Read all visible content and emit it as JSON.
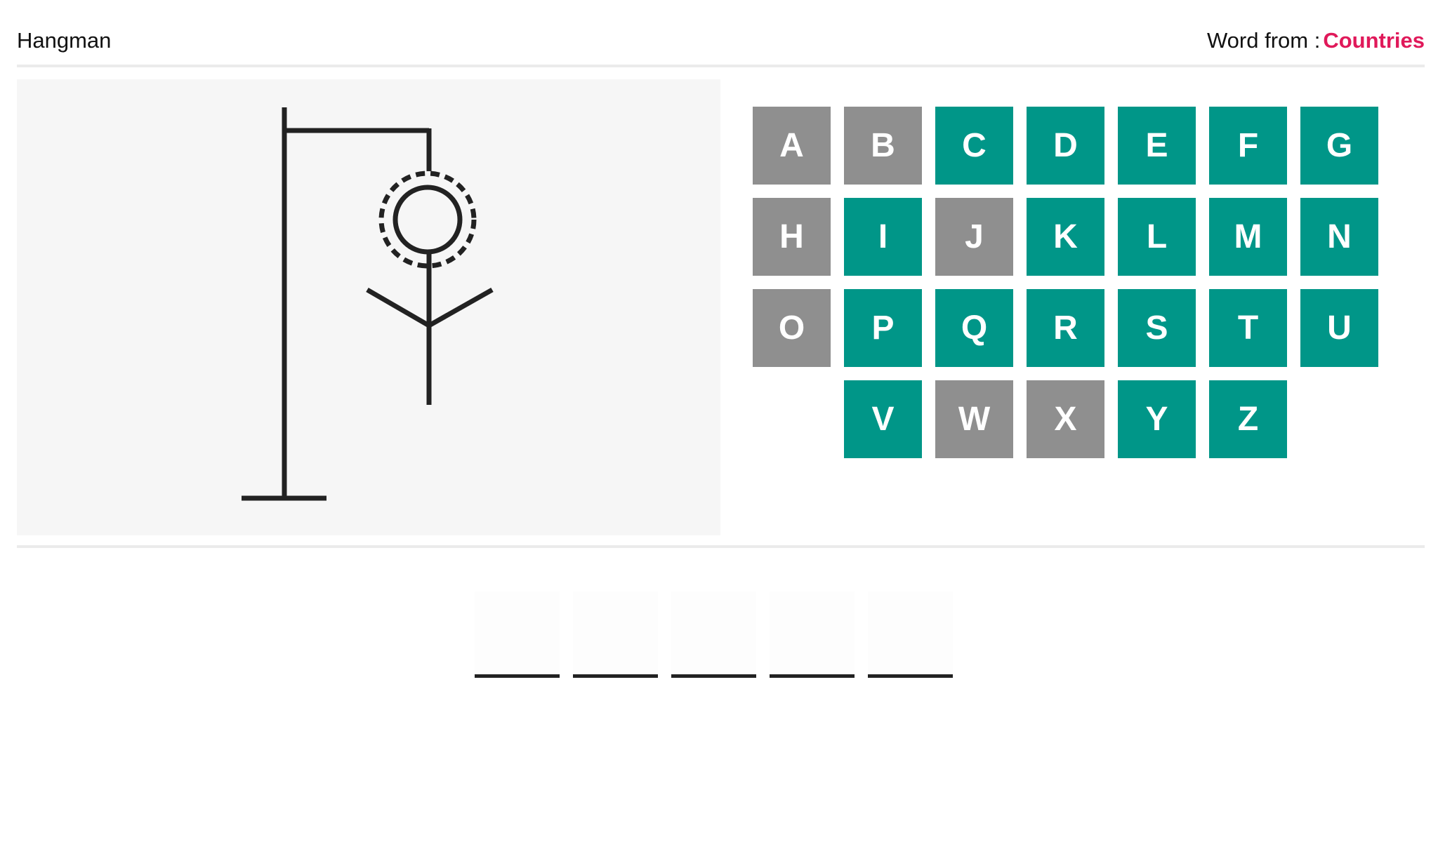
{
  "header": {
    "title": "Hangman",
    "word_from_label": "Word from :",
    "category": "Countries"
  },
  "colors": {
    "available_key": "#009688",
    "used_key": "#8f8f8f",
    "category": "#e0195a",
    "drawing": "#222222"
  },
  "hangman": {
    "parts_shown": [
      "gallows",
      "head",
      "body",
      "arms"
    ],
    "head_highlight": "dashed-ring"
  },
  "keyboard": {
    "rows": [
      [
        {
          "letter": "A",
          "state": "used"
        },
        {
          "letter": "B",
          "state": "used"
        },
        {
          "letter": "C",
          "state": "available"
        },
        {
          "letter": "D",
          "state": "available"
        },
        {
          "letter": "E",
          "state": "available"
        },
        {
          "letter": "F",
          "state": "available"
        },
        {
          "letter": "G",
          "state": "available"
        }
      ],
      [
        {
          "letter": "H",
          "state": "used"
        },
        {
          "letter": "I",
          "state": "available"
        },
        {
          "letter": "J",
          "state": "used"
        },
        {
          "letter": "K",
          "state": "available"
        },
        {
          "letter": "L",
          "state": "available"
        },
        {
          "letter": "M",
          "state": "available"
        },
        {
          "letter": "N",
          "state": "available"
        }
      ],
      [
        {
          "letter": "O",
          "state": "used"
        },
        {
          "letter": "P",
          "state": "available"
        },
        {
          "letter": "Q",
          "state": "available"
        },
        {
          "letter": "R",
          "state": "available"
        },
        {
          "letter": "S",
          "state": "available"
        },
        {
          "letter": "T",
          "state": "available"
        },
        {
          "letter": "U",
          "state": "available"
        }
      ],
      [
        {
          "letter": "V",
          "state": "available"
        },
        {
          "letter": "W",
          "state": "used"
        },
        {
          "letter": "X",
          "state": "used"
        },
        {
          "letter": "Y",
          "state": "available"
        },
        {
          "letter": "Z",
          "state": "available"
        }
      ]
    ]
  },
  "word": {
    "length": 5,
    "revealed": [
      "",
      "",
      "",
      "",
      ""
    ]
  }
}
